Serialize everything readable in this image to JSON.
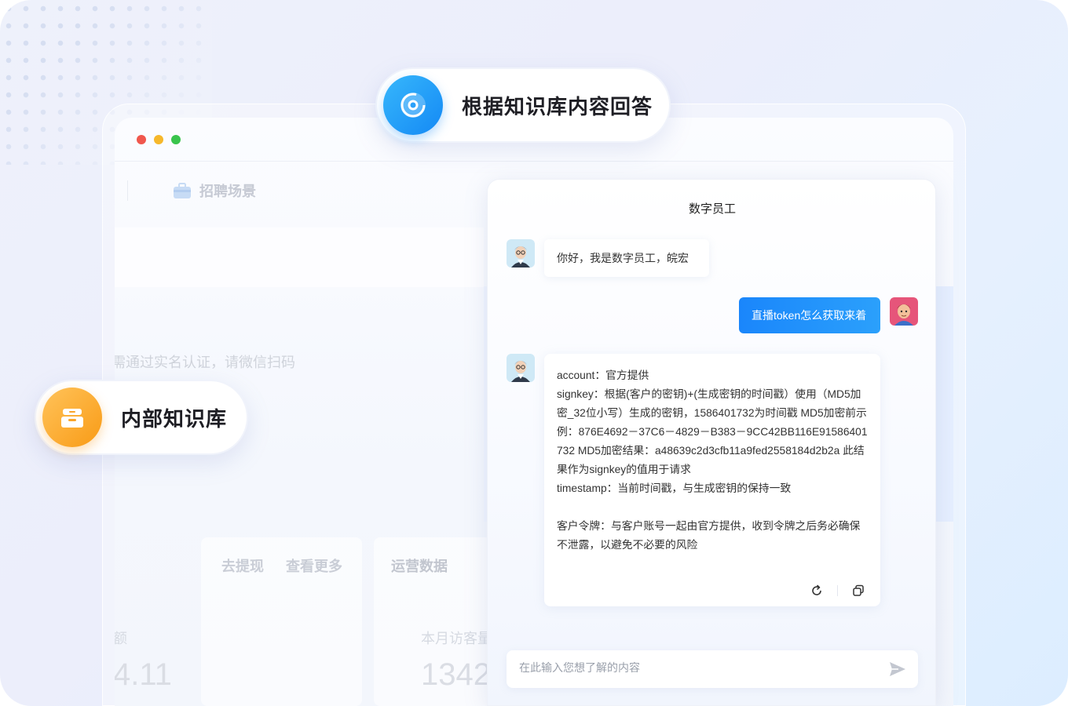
{
  "badges": {
    "top": {
      "label": "根据知识库内容回答",
      "icon": "chrome-ai-icon"
    },
    "left": {
      "label": "内部知识库",
      "icon": "toolbox-icon"
    }
  },
  "background_app": {
    "scene_title": "招聘场景",
    "verify_text": "需通过实名认证，请微信扫码",
    "links": [
      "去提现",
      "查看更多"
    ],
    "section_title": "运营数据",
    "stat_label_left": "额",
    "stat_value_left": "4.11",
    "stat_label_right": "本月访客量",
    "stat_value_right": "1342"
  },
  "chat": {
    "title": "数字员工",
    "messages": [
      {
        "role": "bot",
        "text": "你好，我是数字员工，皖宏"
      },
      {
        "role": "user",
        "text": "直播token怎么获取来着"
      },
      {
        "role": "bot",
        "lines": [
          "account：官方提供",
          "signkey：根据(客户的密钥)+(生成密钥的时间戳）使用（MD5加密_32位小写）生成的密钥，1586401732为时间戳  MD5加密前示例：876E4692－37C6－4829－B383－9CC42BB116E91586401732  MD5加密结果：a48639c2d3cfb11a9fed2558184d2b2a  此结果作为signkey的值用于请求",
          "timestamp：当前时间戳，与生成密钥的保持一致",
          "",
          "客户令牌：与客户账号一起由官方提供，收到令牌之后务必确保不泄露，以避免不必要的风险"
        ]
      }
    ],
    "input_placeholder": "在此输入您想了解的内容"
  },
  "colors": {
    "accent_blue": "#1a86fb",
    "accent_orange": "#f99b16",
    "traffic_red": "#f0574d",
    "traffic_yellow": "#f6b82b",
    "traffic_green": "#39c44c"
  }
}
